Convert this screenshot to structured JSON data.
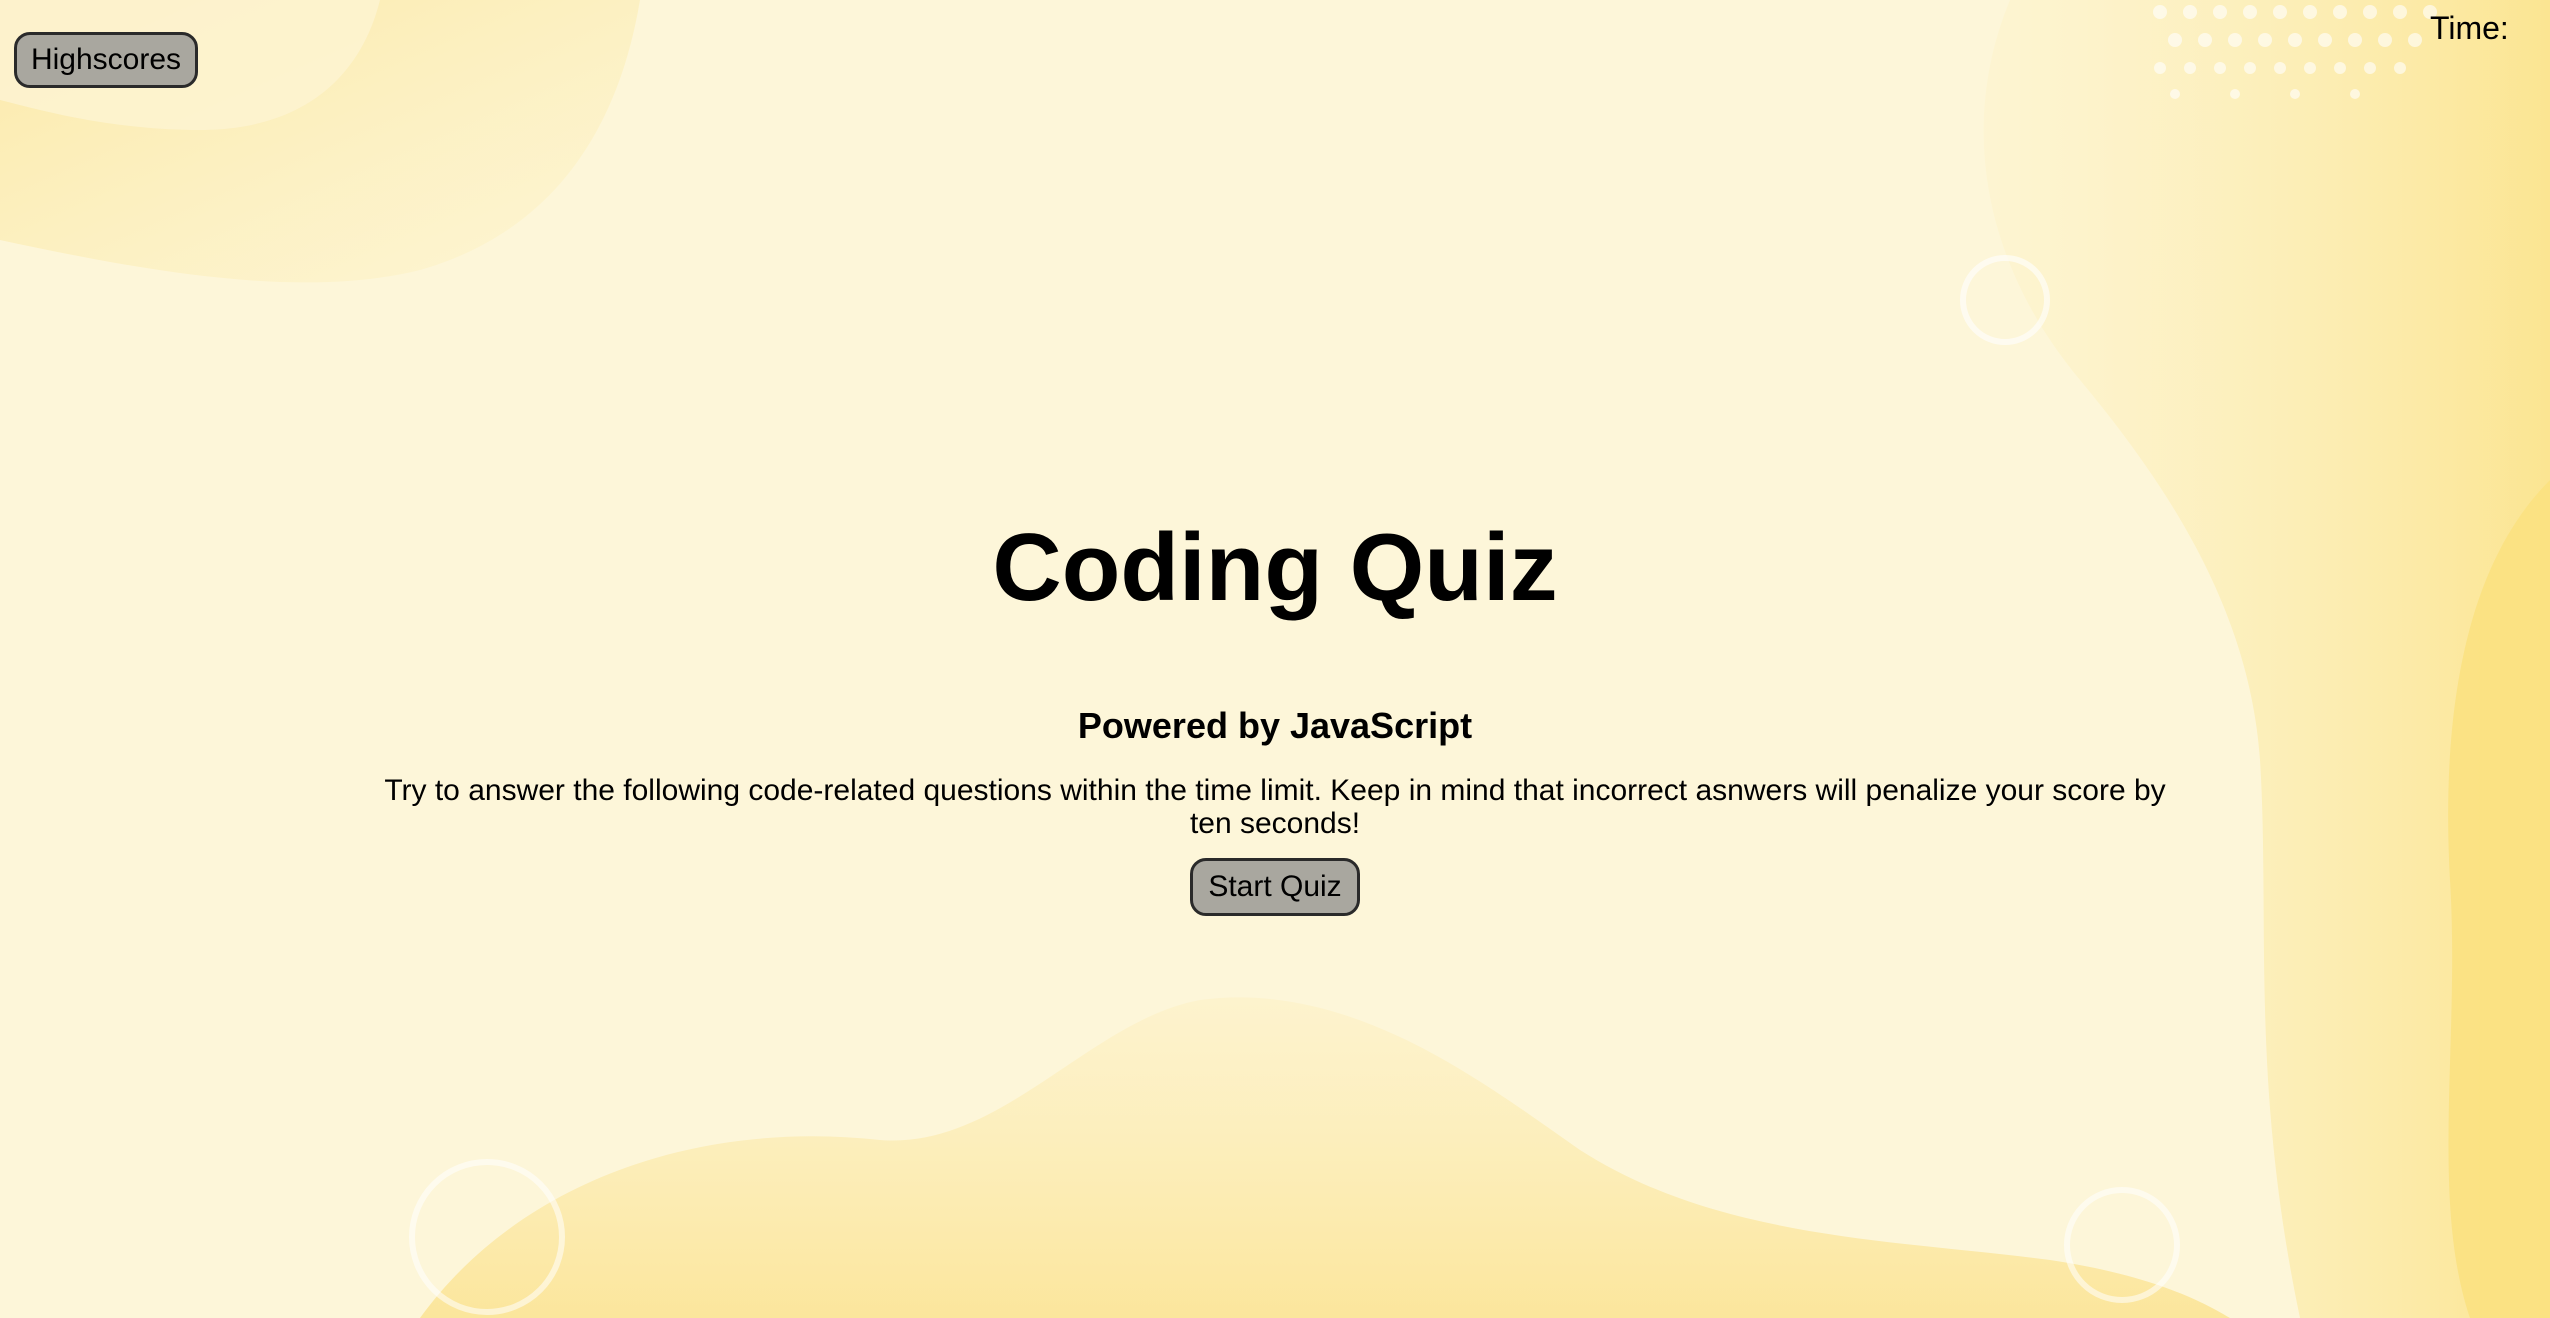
{
  "nav": {
    "highscores_label": "Highscores"
  },
  "timer": {
    "label": "Time:",
    "value": ""
  },
  "quiz": {
    "title": "Coding Quiz",
    "subtitle": "Powered by JavaScript",
    "description": "Try to answer the following code-related questions within the time limit. Keep in mind that incorrect asnwers will penalize your score by ten seconds!",
    "start_label": "Start Quiz"
  },
  "theme": {
    "background": "#fdf6d9",
    "blob_color": "#fbe9a0",
    "button_bg": "#a9a79f",
    "button_border": "#2a2a2a"
  }
}
